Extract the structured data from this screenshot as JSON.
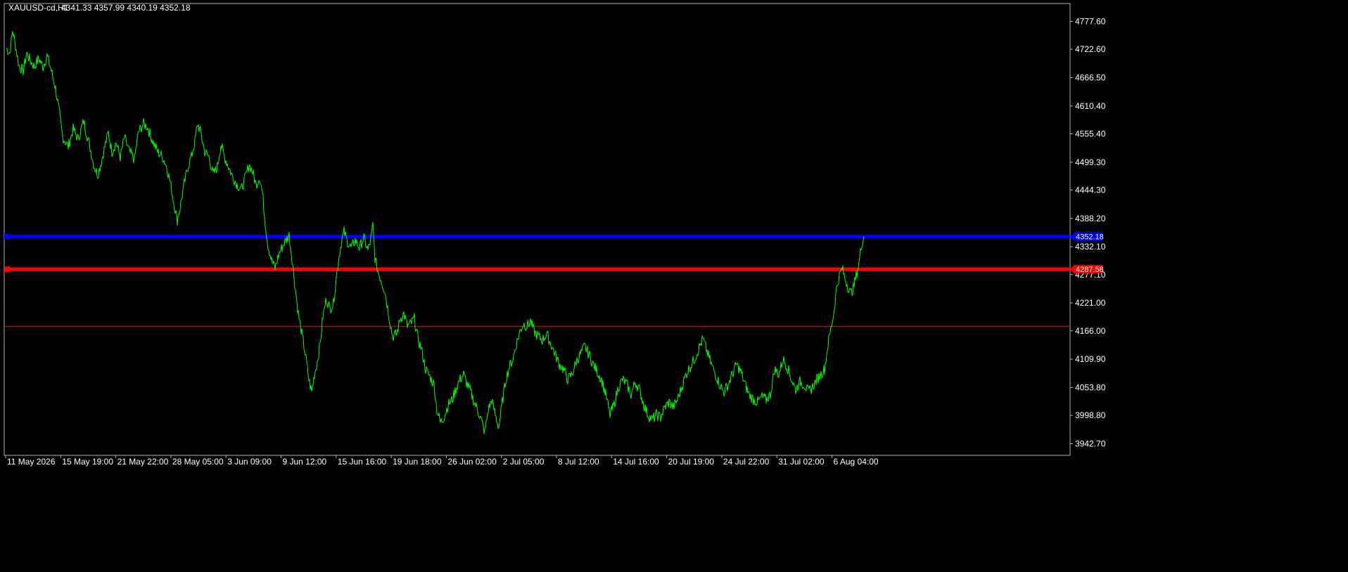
{
  "header": {
    "symbol": "XAUUSD-cd,H1",
    "ohlc": "4341.33 4357.99 4340.19 4352.18"
  },
  "colors": {
    "background": "#000000",
    "frame": "#b4b4b4",
    "price_line": "#00ff00",
    "level_blue": "#0000ff",
    "level_red": "#ff0000",
    "level_thin": "#ff0000"
  },
  "chart_data": {
    "type": "line",
    "title": "XAUUSD-cd,H1",
    "xlabel": "",
    "ylabel": "",
    "ylim": [
      3915.0,
      4805.0
    ],
    "grid": false,
    "price_ticks": [
      4777.6,
      4722.6,
      4666.5,
      4610.4,
      4555.4,
      4499.3,
      4444.3,
      4388.2,
      4332.1,
      4277.1,
      4221.0,
      4166.0,
      4109.9,
      4053.8,
      3998.8,
      3942.7
    ],
    "price_tick_labels": [
      "4777.60",
      "4722.60",
      "4666.50",
      "4610.40",
      "4555.40",
      "4499.30",
      "4444.30",
      "4388.20",
      "4332.10",
      "4277.10",
      "4221.00",
      "4166.00",
      "4109.90",
      "4053.80",
      "3998.80",
      "3942.70"
    ],
    "time_ticks": [
      "11 May 2026",
      "15 May 19:00",
      "21 May 22:00",
      "28 May 05:00",
      "3 Jun 09:00",
      "9 Jun 12:00",
      "15 Jun 16:00",
      "19 Jun 18:00",
      "26 Jun 02:00",
      "2 Jul 05:00",
      "8 Jul 12:00",
      "14 Jul 16:00",
      "20 Jul 19:00",
      "24 Jul 22:00",
      "31 Jul 02:00",
      "6 Aug 04:00"
    ],
    "x_range": [
      0,
      1540
    ],
    "levels": [
      {
        "price": 4352.18,
        "label": "4352.18",
        "color": "#0000ff",
        "style": "thick"
      },
      {
        "price": 4287.58,
        "label": "4287.58",
        "color": "#ff0000",
        "style": "thick"
      },
      {
        "price": 4175.0,
        "label": "",
        "color": "#ff0000",
        "style": "thin"
      }
    ],
    "series": [
      {
        "color": "#00ff00",
        "points": [
          [
            0,
            4725
          ],
          [
            5,
            4715
          ],
          [
            9,
            4760
          ],
          [
            13,
            4730
          ],
          [
            18,
            4690
          ],
          [
            24,
            4680
          ],
          [
            29,
            4715
          ],
          [
            34,
            4700
          ],
          [
            40,
            4688
          ],
          [
            46,
            4705
          ],
          [
            52,
            4688
          ],
          [
            58,
            4710
          ],
          [
            64,
            4680
          ],
          [
            70,
            4645
          ],
          [
            75,
            4600
          ],
          [
            80,
            4550
          ],
          [
            88,
            4530
          ],
          [
            95,
            4565
          ],
          [
            102,
            4545
          ],
          [
            110,
            4580
          ],
          [
            118,
            4535
          ],
          [
            125,
            4490
          ],
          [
            130,
            4475
          ],
          [
            135,
            4500
          ],
          [
            140,
            4530
          ],
          [
            145,
            4558
          ],
          [
            150,
            4520
          ],
          [
            156,
            4538
          ],
          [
            162,
            4510
          ],
          [
            168,
            4548
          ],
          [
            175,
            4520
          ],
          [
            182,
            4505
          ],
          [
            188,
            4560
          ],
          [
            195,
            4575
          ],
          [
            200,
            4570
          ],
          [
            207,
            4545
          ],
          [
            215,
            4520
          ],
          [
            222,
            4510
          ],
          [
            228,
            4490
          ],
          [
            233,
            4460
          ],
          [
            238,
            4420
          ],
          [
            243,
            4385
          ],
          [
            247,
            4410
          ],
          [
            252,
            4450
          ],
          [
            258,
            4490
          ],
          [
            263,
            4510
          ],
          [
            268,
            4540
          ],
          [
            272,
            4575
          ],
          [
            276,
            4560
          ],
          [
            282,
            4520
          ],
          [
            288,
            4510
          ],
          [
            294,
            4475
          ],
          [
            300,
            4490
          ],
          [
            305,
            4535
          ],
          [
            310,
            4510
          ],
          [
            316,
            4490
          ],
          [
            322,
            4470
          ],
          [
            328,
            4455
          ],
          [
            334,
            4445
          ],
          [
            340,
            4470
          ],
          [
            345,
            4495
          ],
          [
            350,
            4480
          ],
          [
            355,
            4455
          ],
          [
            360,
            4470
          ],
          [
            364,
            4440
          ],
          [
            368,
            4380
          ],
          [
            372,
            4335
          ],
          [
            377,
            4305
          ],
          [
            382,
            4290
          ],
          [
            388,
            4320
          ],
          [
            395,
            4340
          ],
          [
            402,
            4355
          ],
          [
            406,
            4310
          ],
          [
            410,
            4260
          ],
          [
            415,
            4200
          ],
          [
            420,
            4160
          ],
          [
            425,
            4120
          ],
          [
            430,
            4070
          ],
          [
            434,
            4045
          ],
          [
            438,
            4080
          ],
          [
            442,
            4105
          ],
          [
            446,
            4140
          ],
          [
            450,
            4195
          ],
          [
            455,
            4230
          ],
          [
            460,
            4210
          ],
          [
            465,
            4220
          ],
          [
            468,
            4260
          ],
          [
            472,
            4305
          ],
          [
            476,
            4340
          ],
          [
            480,
            4362
          ],
          [
            485,
            4342
          ],
          [
            490,
            4330
          ],
          [
            496,
            4345
          ],
          [
            502,
            4330
          ],
          [
            508,
            4350
          ],
          [
            514,
            4325
          ],
          [
            518,
            4345
          ],
          [
            521,
            4375
          ],
          [
            524,
            4310
          ],
          [
            528,
            4285
          ],
          [
            533,
            4265
          ],
          [
            538,
            4245
          ],
          [
            544,
            4195
          ],
          [
            549,
            4155
          ],
          [
            555,
            4160
          ],
          [
            560,
            4190
          ],
          [
            565,
            4200
          ],
          [
            570,
            4175
          ],
          [
            575,
            4180
          ],
          [
            580,
            4190
          ],
          [
            585,
            4150
          ],
          [
            590,
            4130
          ],
          [
            596,
            4090
          ],
          [
            602,
            4075
          ],
          [
            608,
            4060
          ],
          [
            612,
            4010
          ],
          [
            617,
            3985
          ],
          [
            622,
            3995
          ],
          [
            628,
            4020
          ],
          [
            634,
            4030
          ],
          [
            640,
            4055
          ],
          [
            645,
            4070
          ],
          [
            650,
            4080
          ],
          [
            655,
            4060
          ],
          [
            660,
            4045
          ],
          [
            665,
            4025
          ],
          [
            670,
            4010
          ],
          [
            675,
            3990
          ],
          [
            680,
            3965
          ],
          [
            685,
            4010
          ],
          [
            690,
            4030
          ],
          [
            695,
            4000
          ],
          [
            700,
            3975
          ],
          [
            705,
            4025
          ],
          [
            710,
            4070
          ],
          [
            715,
            4095
          ],
          [
            720,
            4110
          ],
          [
            725,
            4140
          ],
          [
            730,
            4165
          ],
          [
            735,
            4180
          ],
          [
            740,
            4175
          ],
          [
            745,
            4185
          ],
          [
            750,
            4165
          ],
          [
            756,
            4155
          ],
          [
            762,
            4148
          ],
          [
            768,
            4160
          ],
          [
            774,
            4140
          ],
          [
            780,
            4120
          ],
          [
            786,
            4100
          ],
          [
            792,
            4090
          ],
          [
            798,
            4070
          ],
          [
            804,
            4080
          ],
          [
            810,
            4105
          ],
          [
            816,
            4120
          ],
          [
            822,
            4135
          ],
          [
            828,
            4120
          ],
          [
            834,
            4100
          ],
          [
            840,
            4085
          ],
          [
            846,
            4070
          ],
          [
            852,
            4040
          ],
          [
            858,
            4000
          ],
          [
            864,
            4020
          ],
          [
            870,
            4055
          ],
          [
            876,
            4070
          ],
          [
            882,
            4060
          ],
          [
            888,
            4040
          ],
          [
            894,
            4065
          ],
          [
            900,
            4050
          ],
          [
            906,
            4020
          ],
          [
            912,
            4000
          ],
          [
            918,
            3990
          ],
          [
            924,
            4000
          ],
          [
            930,
            3995
          ],
          [
            936,
            4015
          ],
          [
            942,
            4025
          ],
          [
            948,
            4015
          ],
          [
            954,
            4030
          ],
          [
            960,
            4055
          ],
          [
            966,
            4080
          ],
          [
            972,
            4095
          ],
          [
            978,
            4110
          ],
          [
            984,
            4130
          ],
          [
            990,
            4150
          ],
          [
            996,
            4125
          ],
          [
            1002,
            4100
          ],
          [
            1008,
            4080
          ],
          [
            1014,
            4060
          ],
          [
            1020,
            4045
          ],
          [
            1026,
            4060
          ],
          [
            1032,
            4080
          ],
          [
            1038,
            4100
          ],
          [
            1044,
            4085
          ],
          [
            1050,
            4060
          ],
          [
            1056,
            4040
          ],
          [
            1062,
            4030
          ],
          [
            1068,
            4025
          ],
          [
            1074,
            4035
          ],
          [
            1080,
            4030
          ],
          [
            1086,
            4040
          ],
          [
            1092,
            4090
          ],
          [
            1098,
            4080
          ],
          [
            1104,
            4110
          ],
          [
            1110,
            4095
          ],
          [
            1116,
            4070
          ],
          [
            1122,
            4050
          ],
          [
            1128,
            4065
          ],
          [
            1134,
            4060
          ],
          [
            1140,
            4045
          ],
          [
            1146,
            4055
          ],
          [
            1152,
            4070
          ],
          [
            1158,
            4080
          ],
          [
            1163,
            4090
          ],
          [
            1168,
            4140
          ],
          [
            1172,
            4170
          ],
          [
            1176,
            4200
          ],
          [
            1180,
            4250
          ],
          [
            1184,
            4275
          ],
          [
            1188,
            4290
          ],
          [
            1192,
            4270
          ],
          [
            1196,
            4255
          ],
          [
            1200,
            4240
          ],
          [
            1204,
            4250
          ],
          [
            1208,
            4275
          ],
          [
            1212,
            4300
          ],
          [
            1216,
            4340
          ],
          [
            1219,
            4352
          ]
        ]
      }
    ]
  }
}
